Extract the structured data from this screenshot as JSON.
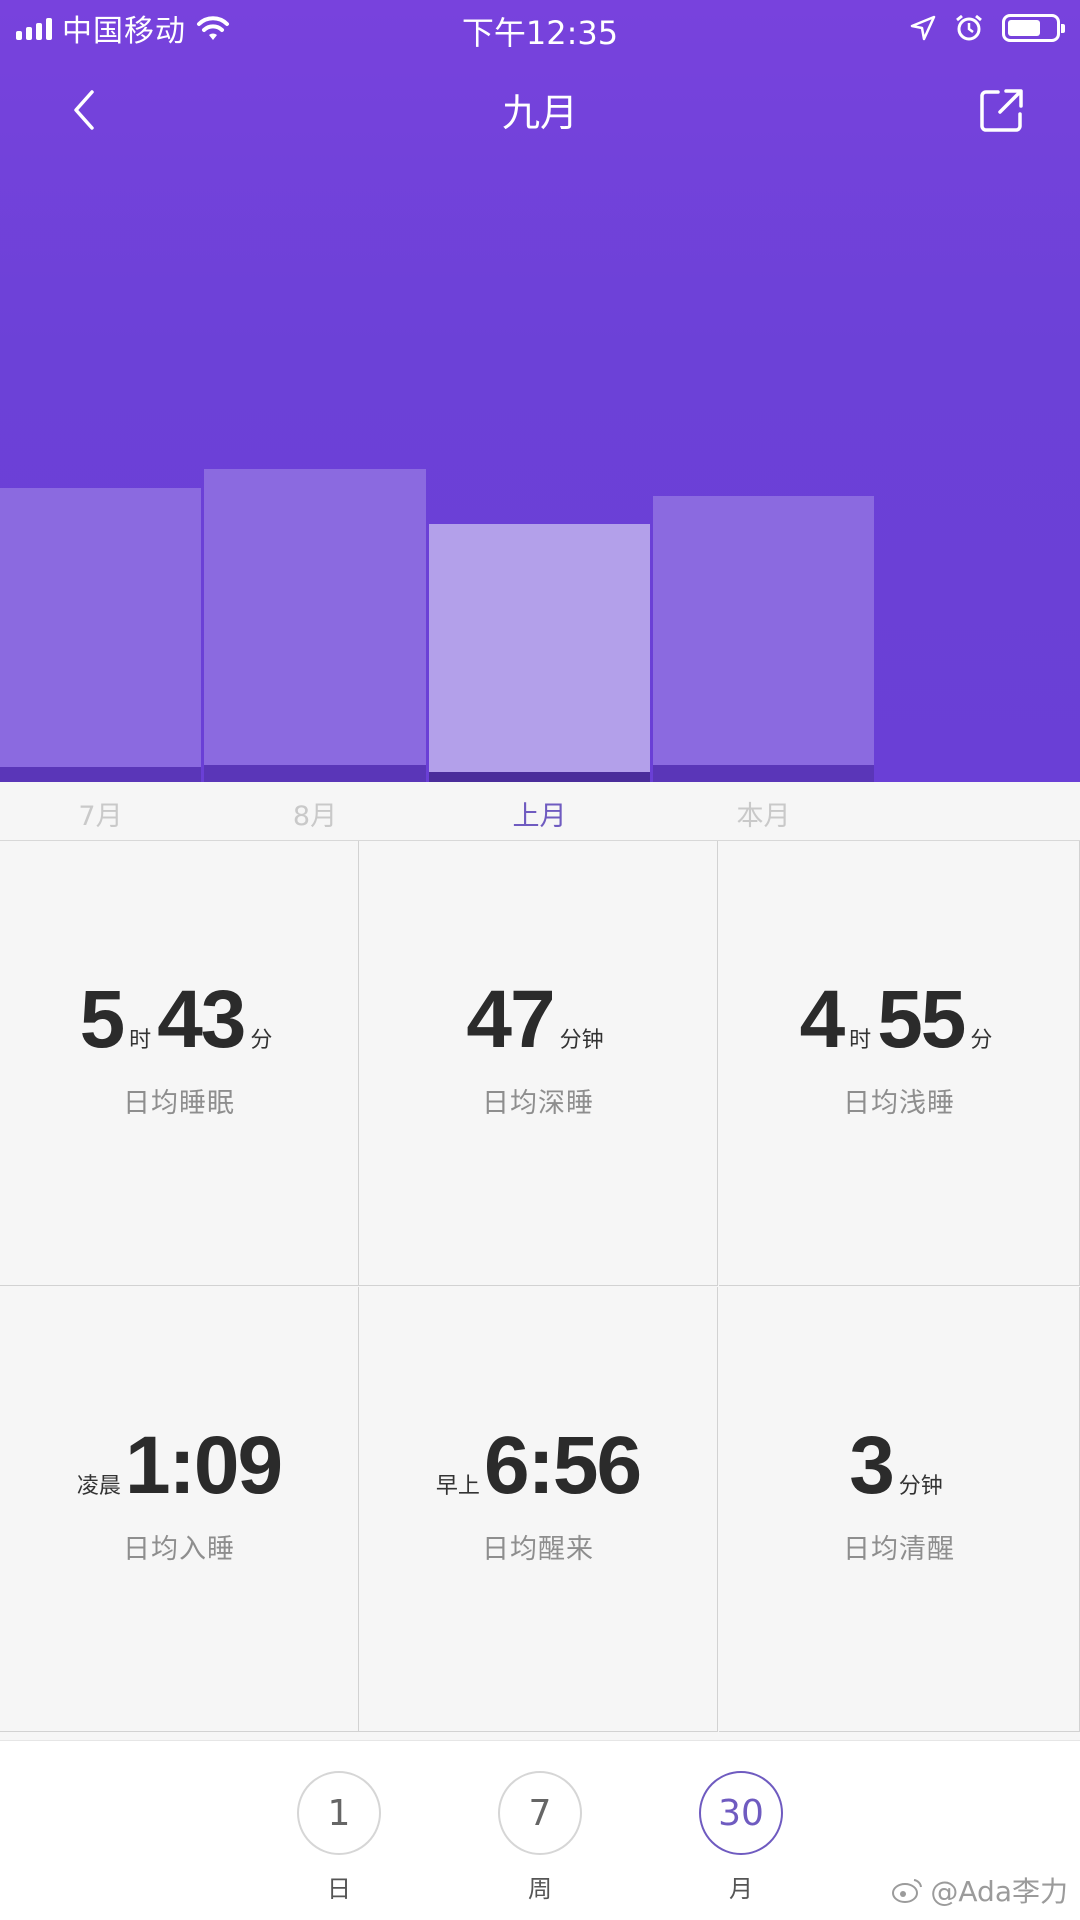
{
  "status_bar": {
    "carrier": "中国移动",
    "time": "下午12:35"
  },
  "nav": {
    "title": "九月"
  },
  "chart_data": {
    "type": "bar",
    "categories": [
      "7月",
      "8月",
      "上月",
      "本月"
    ],
    "selected_category": "上月",
    "series": [
      {
        "values": [
          8.2,
          8.7,
          7.3,
          7.9
        ]
      },
      {
        "values": [
          0.9,
          1.0,
          0.6,
          1.0
        ]
      }
    ],
    "colors": {
      "top": "#8b6ae0",
      "bottom": "#5a36b8",
      "selected_top": "#b3a0ea",
      "selected_bottom": "#4a2d9a"
    }
  },
  "stats": [
    {
      "parts": [
        {
          "t": "big",
          "v": "5"
        },
        {
          "t": "unit",
          "v": "时"
        },
        {
          "t": "big",
          "v": "43"
        },
        {
          "t": "unit",
          "v": "分"
        }
      ],
      "label": "日均睡眠"
    },
    {
      "parts": [
        {
          "t": "big",
          "v": "47"
        },
        {
          "t": "unit",
          "v": "分钟"
        }
      ],
      "label": "日均深睡"
    },
    {
      "parts": [
        {
          "t": "big",
          "v": "4"
        },
        {
          "t": "unit",
          "v": "时"
        },
        {
          "t": "big",
          "v": "55"
        },
        {
          "t": "unit",
          "v": "分"
        }
      ],
      "label": "日均浅睡"
    },
    {
      "parts": [
        {
          "t": "prefix",
          "v": "凌晨"
        },
        {
          "t": "big",
          "v": "1:09"
        }
      ],
      "label": "日均入睡"
    },
    {
      "parts": [
        {
          "t": "prefix",
          "v": "早上"
        },
        {
          "t": "big",
          "v": "6:56"
        }
      ],
      "label": "日均醒来"
    },
    {
      "parts": [
        {
          "t": "big",
          "v": "3"
        },
        {
          "t": "unit",
          "v": "分钟"
        }
      ],
      "label": "日均清醒"
    }
  ],
  "periods": [
    {
      "number": "1",
      "label": "日"
    },
    {
      "number": "7",
      "label": "周"
    },
    {
      "number": "30",
      "label": "月",
      "active": true
    }
  ],
  "watermark": "@Ada李力"
}
